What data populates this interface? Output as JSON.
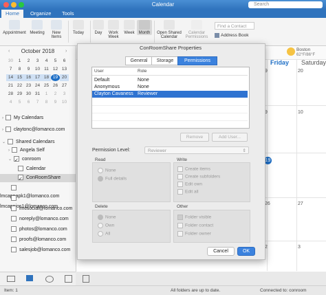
{
  "window": {
    "title": "Calendar",
    "search_placeholder": "Search"
  },
  "ribbon": {
    "tabs": [
      "Home",
      "Organize",
      "Tools"
    ],
    "buttons": [
      "Appointment",
      "Meeting",
      "New Items",
      "Today",
      "Day",
      "Work Week",
      "Week",
      "Month",
      "Open Shared Calendar",
      "Calendar Permissions"
    ],
    "contact_placeholder": "Find a Contact",
    "address_book": "Address Book"
  },
  "mini_calendar": {
    "month": "October 2018",
    "weeks": [
      [
        "30",
        "1",
        "2",
        "3",
        "4",
        "5",
        "6"
      ],
      [
        "7",
        "8",
        "9",
        "10",
        "11",
        "12",
        "13"
      ],
      [
        "14",
        "15",
        "16",
        "17",
        "18",
        "19",
        "20"
      ],
      [
        "21",
        "22",
        "23",
        "24",
        "25",
        "26",
        "27"
      ],
      [
        "28",
        "29",
        "30",
        "31",
        "1",
        "2",
        "3"
      ],
      [
        "4",
        "5",
        "6",
        "7",
        "8",
        "9",
        "10"
      ]
    ],
    "today": "19"
  },
  "calendars": {
    "my_calendars": "My Calendars",
    "account": "claytonc@lomanco.com",
    "shared_calendars": "Shared Calendars",
    "items": [
      "Angela Self",
      "conroom",
      "Calendar",
      "ConRoomShare",
      "lmcappapk1@lomanco.com",
      "lmcappios1@lomanco.com",
      "lmcsocial@lomanco.com",
      "noreply@lomanco.com",
      "photos@lomanco.com",
      "proofs@lomanco.com",
      "salesjob@lomanco.com"
    ]
  },
  "main": {
    "days": [
      "Friday",
      "Saturday"
    ],
    "dates": [
      "9",
      "20",
      "10",
      "9",
      "19",
      "26",
      "27",
      "2",
      "3"
    ],
    "weather": {
      "label": "Boston",
      "temp": "62°F/86°F"
    }
  },
  "dialog": {
    "title": "ConRoomShare Properties",
    "tabs": [
      "General",
      "Storage",
      "Permissions"
    ],
    "active_tab": "Permissions",
    "table": {
      "columns": [
        "User",
        "Role"
      ],
      "rows": [
        {
          "user": "Default",
          "role": "None"
        },
        {
          "user": "Anonymous",
          "role": "None"
        },
        {
          "user": "Clayton Cavaness",
          "role": "Reviewer"
        }
      ]
    },
    "remove_label": "Remove",
    "add_user_label": "Add User...",
    "permission_level_label": "Permission Level:",
    "permission_level_value": "Reviewer",
    "read": {
      "label": "Read",
      "options": [
        "None",
        "Full details"
      ]
    },
    "write": {
      "label": "Write",
      "options": [
        "Create items",
        "Create subfolders",
        "Edit own",
        "Edit all"
      ]
    },
    "delete": {
      "label": "Delete",
      "options": [
        "None",
        "Own",
        "All"
      ]
    },
    "other": {
      "label": "Other",
      "options": [
        "Folder visible",
        "Folder contact",
        "Folder owner"
      ]
    },
    "cancel_label": "Cancel",
    "ok_label": "OK"
  },
  "status": {
    "items": "Item: 1",
    "sync": "All folders are up to date.",
    "connection": "Connected to: conroom"
  },
  "colors": {
    "accent": "#2f73bd",
    "selection": "#2f73d1"
  }
}
